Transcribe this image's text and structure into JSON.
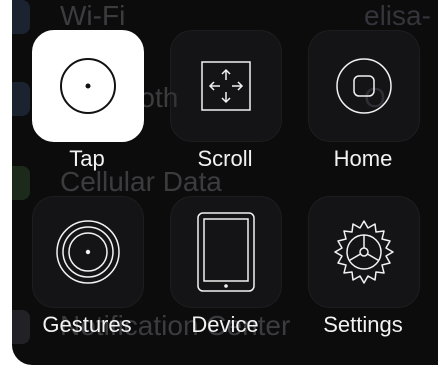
{
  "background_rows": [
    {
      "label": "Wi-Fi",
      "value": "elisa-"
    },
    {
      "label": "Bluetooth",
      "value": "O"
    },
    {
      "label": "Cellular Data",
      "value": ""
    },
    {
      "label": "Notification Center",
      "value": ""
    }
  ],
  "menu": {
    "items": [
      {
        "label": "Tap",
        "icon": "tap-circle-icon",
        "active": true
      },
      {
        "label": "Scroll",
        "icon": "scroll-arrows-icon"
      },
      {
        "label": "Home",
        "icon": "home-button-icon"
      },
      {
        "label": "Gestures",
        "icon": "gestures-rings-icon"
      },
      {
        "label": "Device",
        "icon": "ipad-device-icon"
      },
      {
        "label": "Settings",
        "icon": "settings-gear-icon"
      }
    ]
  },
  "colors": {
    "panel": "#0c0c0d",
    "active_tile": "#ffffff",
    "label": "#f2f2f2"
  }
}
